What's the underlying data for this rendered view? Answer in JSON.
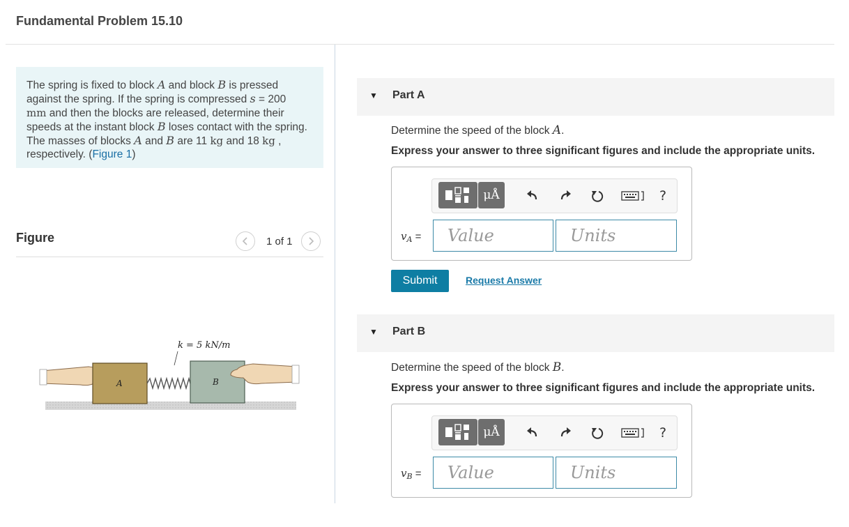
{
  "page": {
    "title": "Fundamental Problem 15.10"
  },
  "problem": {
    "t1": "The spring is fixed to block ",
    "A1": "A",
    "t2": " and block ",
    "B1": "B",
    "t3": " is pressed against the spring. If the spring is compressed ",
    "s": "s",
    "t4": " = 200",
    "mm": "mm",
    "t5": " and then the blocks are released, determine their speeds at the instant block ",
    "B2": "B",
    "t6": " loses contact with the spring. The masses of blocks ",
    "A2": "A",
    "t7": " and ",
    "B3": "B",
    "t8": " are 11 ",
    "kg1": "kg",
    "t9": " and 18 ",
    "kg2": "kg",
    "t10": " , respectively. (",
    "figure_link": "Figure 1",
    "t11": ")"
  },
  "figure": {
    "label": "Figure",
    "count": "1 of 1",
    "prev_icon": "chevron-left-icon",
    "next_icon": "chevron-right-icon",
    "spring_label": "k = 5 kN/m",
    "block_a_label": "A",
    "block_b_label": "B"
  },
  "parts": [
    {
      "title": "Part A",
      "question_text": "Determine the speed of the block ",
      "question_var": "A",
      "question_end": ".",
      "instructions": "Express your answer to three significant figures and include the appropriate units.",
      "var_name": "v",
      "var_sub": "A",
      "equals": " =",
      "value_placeholder": "Value",
      "units_placeholder": "Units",
      "submit_label": "Submit",
      "request_label": "Request Answer"
    },
    {
      "title": "Part B",
      "question_text": "Determine the speed of the block ",
      "question_var": "B",
      "question_end": ".",
      "instructions": "Express your answer to three significant figures and include the appropriate units.",
      "var_name": "v",
      "var_sub": "B",
      "equals": " =",
      "value_placeholder": "Value",
      "units_placeholder": "Units"
    }
  ],
  "toolbar": {
    "symbols_label": "μÅ",
    "help_label": "?",
    "icons": [
      "templates-icon",
      "symbols-icon",
      "undo-icon",
      "redo-icon",
      "reset-icon",
      "keyboard-icon",
      "help-icon"
    ]
  },
  "colors": {
    "accent": "#0e7ea3",
    "problem_bg": "#e9f5f7",
    "link": "#1a6fa5",
    "input_border": "#3c8aa7"
  }
}
